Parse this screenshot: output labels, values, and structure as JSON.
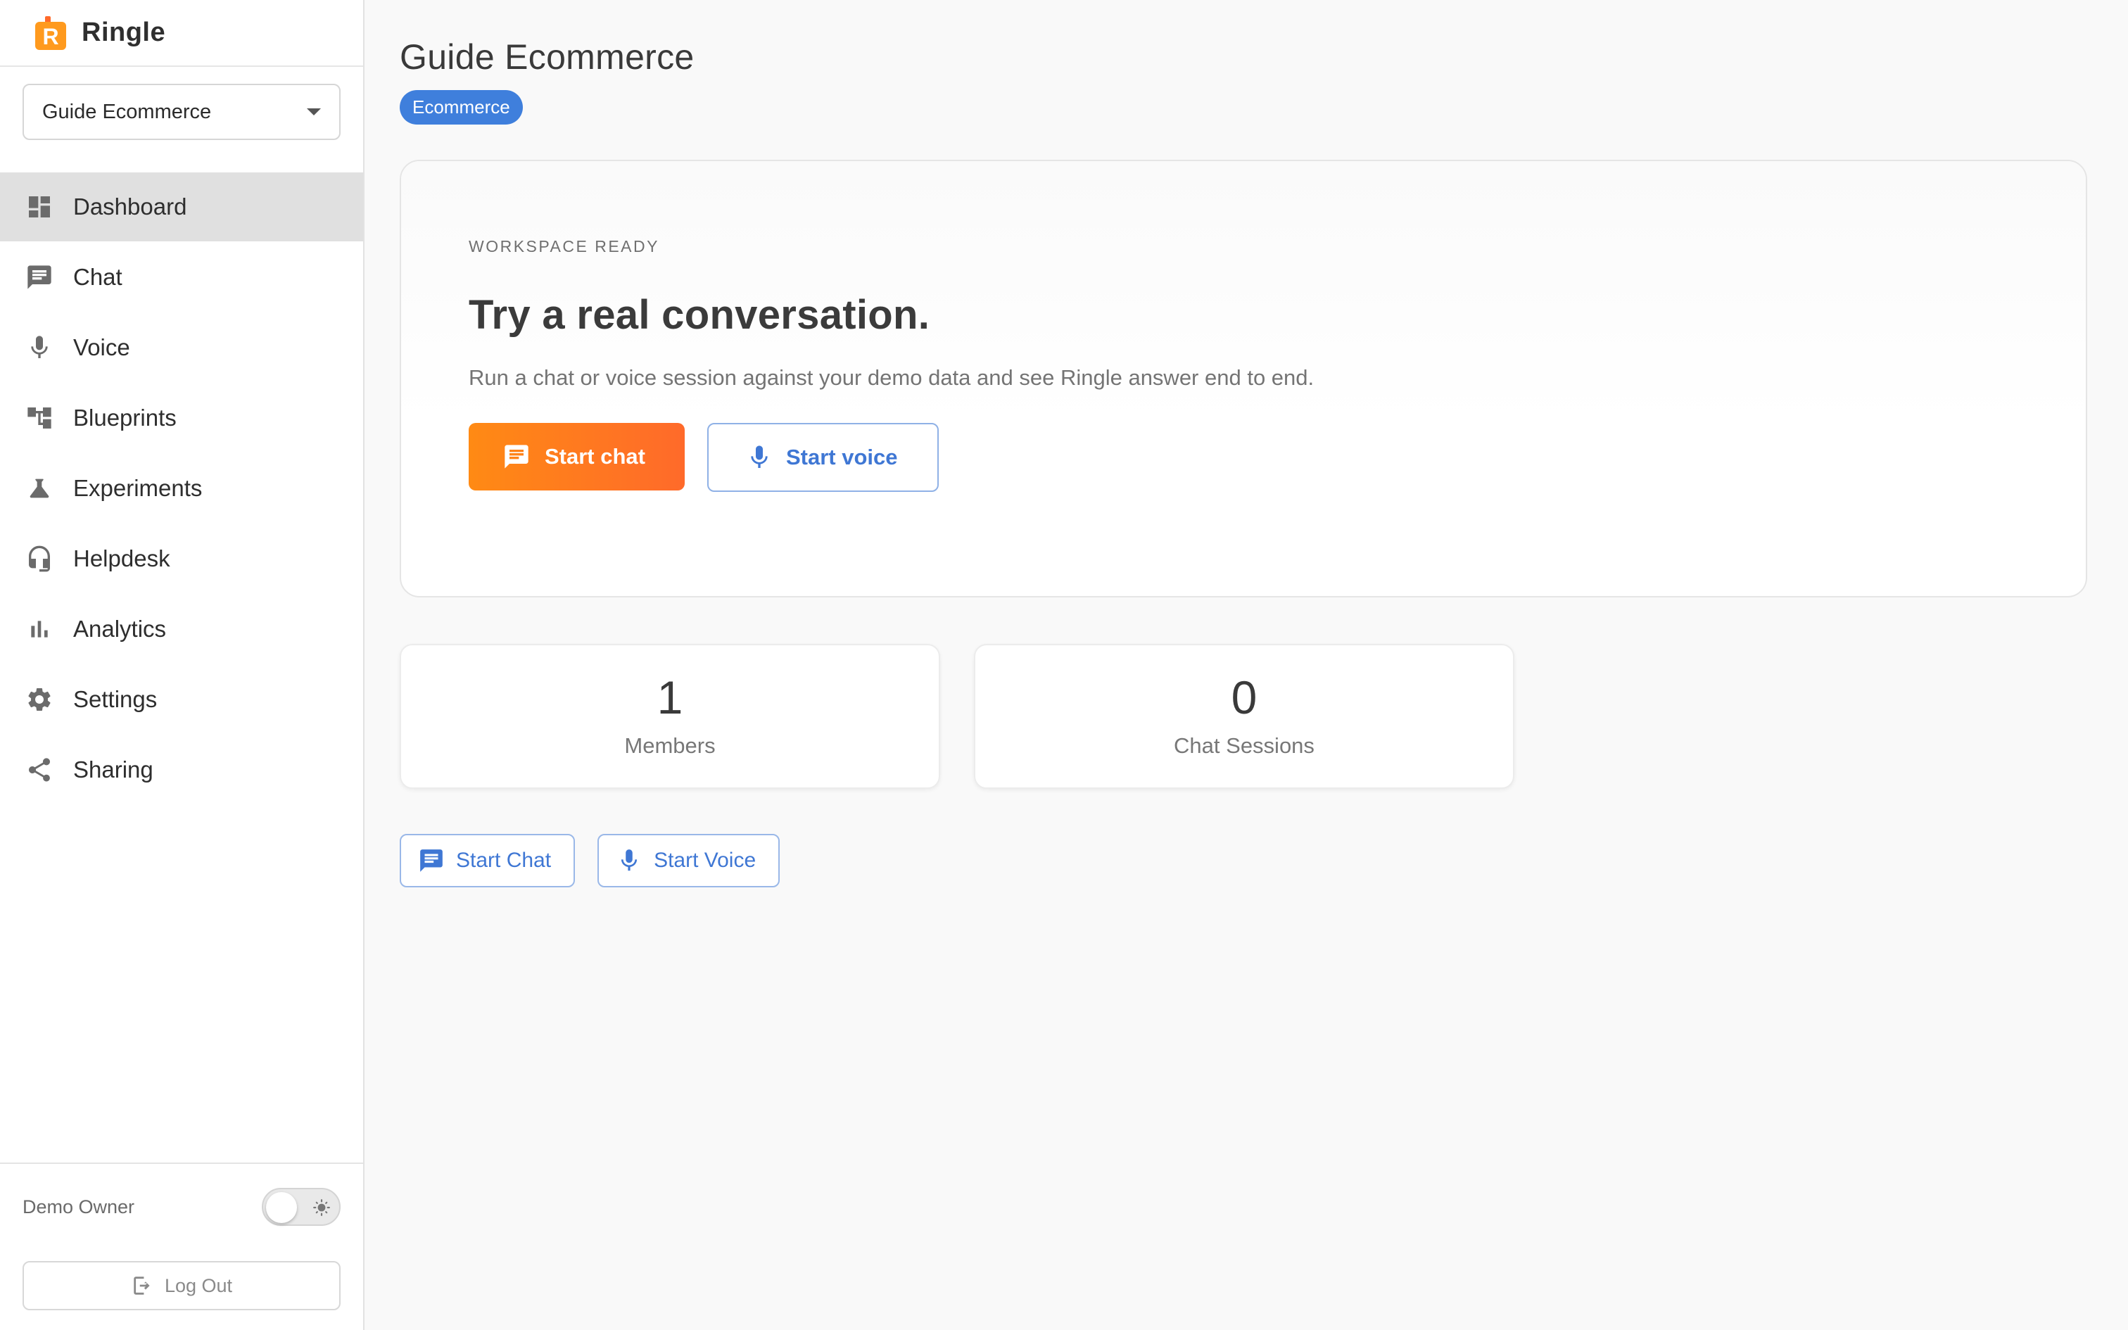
{
  "brand": {
    "name": "Ringle",
    "logo_icon": "ringle-logo-icon",
    "logo_color": "#ff8a14",
    "logo_letter": "R"
  },
  "workspace_selector": {
    "selected": "Guide Ecommerce"
  },
  "nav": {
    "items": [
      {
        "label": "Dashboard",
        "icon": "dashboard-icon",
        "active": true
      },
      {
        "label": "Chat",
        "icon": "chat-icon"
      },
      {
        "label": "Voice",
        "icon": "mic-icon"
      },
      {
        "label": "Blueprints",
        "icon": "blueprint-icon"
      },
      {
        "label": "Experiments",
        "icon": "flask-icon"
      },
      {
        "label": "Helpdesk",
        "icon": "headset-icon"
      },
      {
        "label": "Analytics",
        "icon": "bar-chart-icon"
      },
      {
        "label": "Settings",
        "icon": "gear-icon"
      },
      {
        "label": "Sharing",
        "icon": "share-icon"
      }
    ]
  },
  "footer": {
    "owner": "Demo Owner",
    "logout_label": "Log Out"
  },
  "page": {
    "title": "Guide Ecommerce",
    "tag": "Ecommerce"
  },
  "hero": {
    "eyebrow": "WORKSPACE READY",
    "title": "Try a real conversation.",
    "subtitle": "Run a chat or voice session against your demo data and see Ringle answer end to end.",
    "primary_label": "Start chat",
    "secondary_label": "Start voice"
  },
  "stats": [
    {
      "value": "1",
      "label": "Members"
    },
    {
      "value": "0",
      "label": "Chat Sessions"
    }
  ],
  "quick_actions": {
    "chat_label": "Start Chat",
    "voice_label": "Start Voice"
  },
  "colors": {
    "accent_blue": "#3f7fdc",
    "primary_orange": "#ff7a1e",
    "active_nav": "#e0e0e0"
  }
}
